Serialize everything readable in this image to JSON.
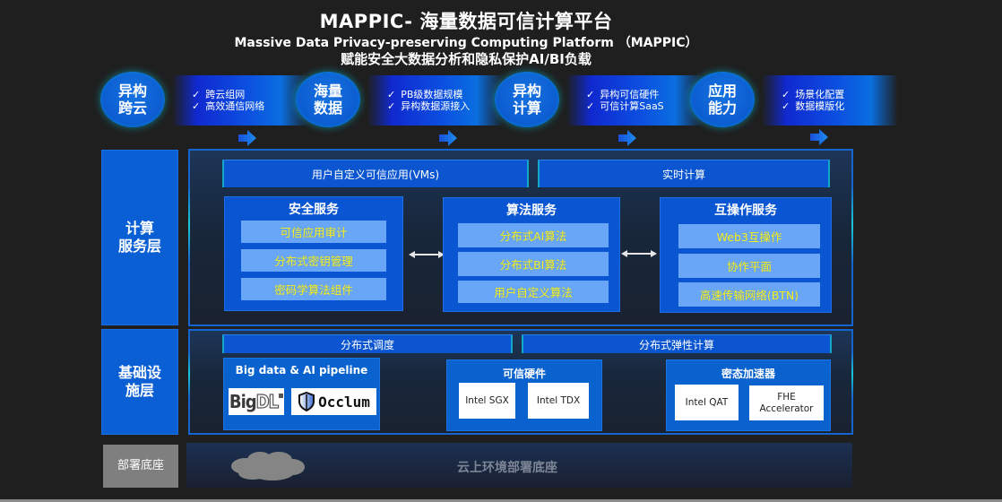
{
  "header": {
    "title": "MAPPIC- 海量数据可信计算平台",
    "title_en": "Massive Data Privacy-preserving Computing  Platform （MAPPIC）",
    "subtitle": "赋能安全大数据分析和隐私保护AI/BI负载"
  },
  "features": [
    {
      "circle_line1": "异构",
      "circle_line2": "跨云",
      "points": [
        "跨云组网",
        "高效通信网络"
      ]
    },
    {
      "circle_line1": "海量",
      "circle_line2": "数据",
      "points": [
        "PB级数据规模",
        "异构数据源接入"
      ]
    },
    {
      "circle_line1": "异构",
      "circle_line2": "计算",
      "points": [
        "异构可信硬件",
        "可信计算SaaS"
      ]
    },
    {
      "circle_line1": "应用",
      "circle_line2": "能力",
      "points": [
        "场景化配置",
        "数据模版化"
      ]
    }
  ],
  "check_mark": "✓",
  "layers": {
    "compute": {
      "label_line1": "计算",
      "label_line2": "服务层",
      "bars": [
        "用户自定义可信应用(VMs)",
        "实时计算"
      ],
      "services": [
        {
          "title": "安全服务",
          "items": [
            "可信应用审计",
            "分布式密钥管理",
            "密码学算法组件"
          ]
        },
        {
          "title": "算法服务",
          "items": [
            "分布式AI算法",
            "分布式BI算法",
            "用户自定义算法"
          ]
        },
        {
          "title": "互操作服务",
          "items": [
            "Web3互操作",
            "协作平面",
            "高速传输网络(BTN)"
          ]
        }
      ]
    },
    "infra": {
      "label_line1": "基础设",
      "label_line2": "施层",
      "bars": [
        "分布式调度",
        "分布式弹性计算"
      ],
      "pipeline": {
        "title": "Big data & AI pipeline",
        "logos": [
          "BigDL",
          "Occlum"
        ]
      },
      "trusted_hw": {
        "title": "可信硬件",
        "items": [
          "Intel SGX",
          "Intel TDX"
        ]
      },
      "accelerator": {
        "title": "密态加速器",
        "items": [
          "Intel QAT",
          "FHE Accelerator"
        ]
      }
    },
    "deploy": {
      "label": "部署底座",
      "text": "云上环境部署底座"
    }
  },
  "colors": {
    "background": "#1f1f1f",
    "primary_blue": "#0b56d0",
    "item_blue": "#69a6f7",
    "item_text_yellow": "#f5f126",
    "glow_cyan": "#19c9d4",
    "deploy_gray": "#7f7f7f"
  }
}
